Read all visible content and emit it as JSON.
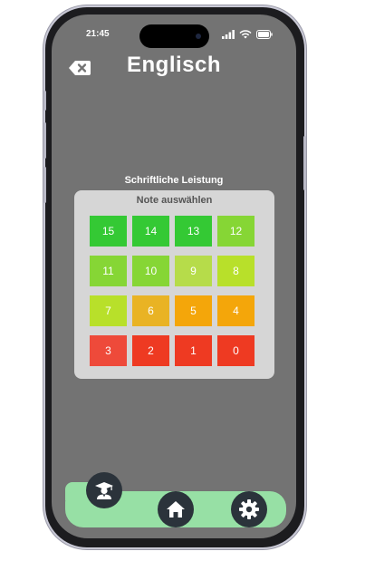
{
  "status": {
    "time": "21:45"
  },
  "header": {
    "title": "Englisch"
  },
  "section": {
    "label": "Schriftliche Leistung"
  },
  "picker": {
    "title": "Note auswählen",
    "grades": [
      {
        "value": "15",
        "color": "#34c934"
      },
      {
        "value": "14",
        "color": "#34c934"
      },
      {
        "value": "13",
        "color": "#34c934"
      },
      {
        "value": "12",
        "color": "#86d635"
      },
      {
        "value": "11",
        "color": "#86d635"
      },
      {
        "value": "10",
        "color": "#86d635"
      },
      {
        "value": "9",
        "color": "#b6dc4a"
      },
      {
        "value": "8",
        "color": "#b8e02a"
      },
      {
        "value": "7",
        "color": "#b8e02a"
      },
      {
        "value": "6",
        "color": "#e9b324"
      },
      {
        "value": "5",
        "color": "#f4a60a"
      },
      {
        "value": "4",
        "color": "#f4a60a"
      },
      {
        "value": "3",
        "color": "#ee4a3a"
      },
      {
        "value": "2",
        "color": "#ee3a22"
      },
      {
        "value": "1",
        "color": "#ee3a22"
      },
      {
        "value": "0",
        "color": "#ee3a22"
      }
    ]
  },
  "nav": {
    "items": [
      {
        "icon": "graduate-icon"
      },
      {
        "icon": "home-icon"
      },
      {
        "icon": "gear-icon"
      }
    ]
  }
}
